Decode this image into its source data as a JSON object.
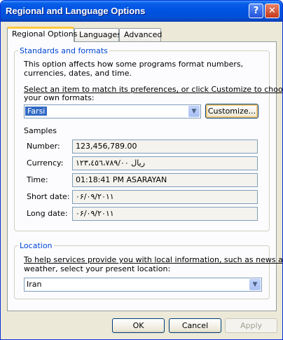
{
  "window": {
    "title": "Regional and Language Options",
    "help_glyph": "?",
    "close_glyph": "✕"
  },
  "tabs": [
    {
      "label": "Regional Options",
      "active": true
    },
    {
      "label": "Languages",
      "active": false
    },
    {
      "label": "Advanced",
      "active": false
    }
  ],
  "standards": {
    "legend": "Standards and formats",
    "description": "This option affects how some programs format numbers, currencies, dates, and time.",
    "select_prompt_line1": "Select an item to match its preferences, or click Customize to choose",
    "select_prompt_line2": "your own formats:",
    "selected_format": "Farsi",
    "customize_label": "Customize...",
    "samples_heading": "Samples",
    "samples": [
      {
        "label": "Number:",
        "value": "123,456,789.00"
      },
      {
        "label": "Currency:",
        "value": "ريال ١٢٣،٤٥٦،٧٨٩/٠٠"
      },
      {
        "label": "Time:",
        "value": "01:18:41 PM ASARAYAN"
      },
      {
        "label": "Short date:",
        "value": "٠۶/٠٩/٢٠١١"
      },
      {
        "label": "Long date:",
        "value": "٠۶/٠٩/٢٠١١"
      }
    ]
  },
  "location": {
    "legend": "Location",
    "description_line1": "To help services provide you with local information, such as news and",
    "description_line2": "weather, select your present location:",
    "selected_location": "Iran"
  },
  "buttons": {
    "ok": "OK",
    "cancel": "Cancel",
    "apply": "Apply"
  }
}
